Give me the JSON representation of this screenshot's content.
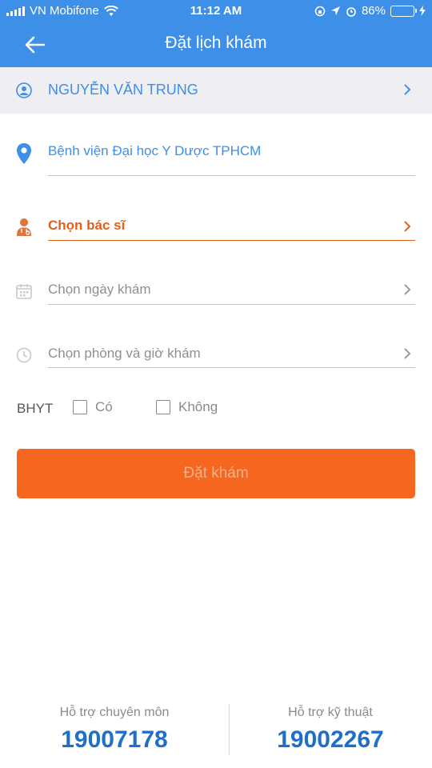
{
  "status_bar": {
    "carrier": "VN Mobifone",
    "time": "11:12 AM",
    "battery_percent": "86%",
    "battery_level": 0.86
  },
  "header": {
    "title": "Đặt lịch khám"
  },
  "patient": {
    "name": "NGUYỄN VĂN TRUNG"
  },
  "form": {
    "hospital": "Bệnh viện Đại học Y Dược TPHCM",
    "doctor_placeholder": "Chọn bác sĩ",
    "date_placeholder": "Chọn ngày khám",
    "room_time_placeholder": "Chọn phòng và giờ khám",
    "bhyt_label": "BHYT",
    "bhyt_yes": "Có",
    "bhyt_no": "Không",
    "submit_label": "Đặt khám"
  },
  "support": {
    "professional_label": "Hỗ trợ chuyên môn",
    "professional_phone": "19007178",
    "technical_label": "Hỗ trợ kỹ thuật",
    "technical_phone": "19002267"
  },
  "colors": {
    "primary_blue": "#3d8fe8",
    "accent_orange": "#f5671f",
    "phone_blue": "#1f6fc9"
  }
}
